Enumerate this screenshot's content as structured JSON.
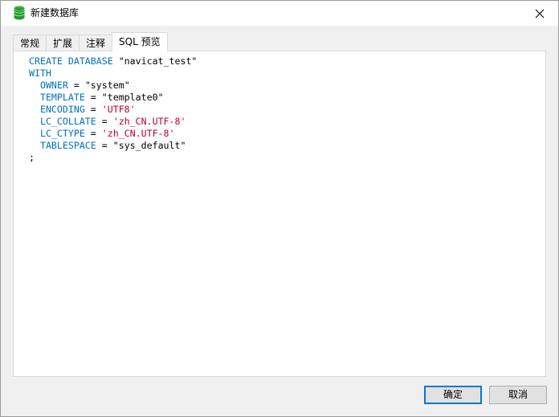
{
  "window": {
    "title": "新建数据库",
    "icon": "database-icon"
  },
  "tabs": [
    {
      "label": "常规",
      "active": false
    },
    {
      "label": "扩展",
      "active": false
    },
    {
      "label": "注释",
      "active": false
    },
    {
      "label": "SQL 预览",
      "active": true
    }
  ],
  "sql": {
    "lines": [
      {
        "indent": "",
        "parts": [
          {
            "t": "kw",
            "v": "CREATE DATABASE"
          },
          {
            "t": "p",
            "v": " "
          },
          {
            "t": "d",
            "v": "\"navicat_test\""
          }
        ]
      },
      {
        "indent": "",
        "parts": [
          {
            "t": "kw",
            "v": "WITH"
          }
        ]
      },
      {
        "indent": "  ",
        "parts": [
          {
            "t": "kw",
            "v": "OWNER"
          },
          {
            "t": "p",
            "v": " = "
          },
          {
            "t": "d",
            "v": "\"system\""
          }
        ]
      },
      {
        "indent": "  ",
        "parts": [
          {
            "t": "kw",
            "v": "TEMPLATE"
          },
          {
            "t": "p",
            "v": " = "
          },
          {
            "t": "d",
            "v": "\"template0\""
          }
        ]
      },
      {
        "indent": "  ",
        "parts": [
          {
            "t": "kw",
            "v": "ENCODING"
          },
          {
            "t": "p",
            "v": " = "
          },
          {
            "t": "s",
            "v": "'UTF8'"
          }
        ]
      },
      {
        "indent": "  ",
        "parts": [
          {
            "t": "kw",
            "v": "LC_COLLATE"
          },
          {
            "t": "p",
            "v": " = "
          },
          {
            "t": "s",
            "v": "'zh_CN.UTF-8'"
          }
        ]
      },
      {
        "indent": "  ",
        "parts": [
          {
            "t": "kw",
            "v": "LC_CTYPE"
          },
          {
            "t": "p",
            "v": " = "
          },
          {
            "t": "s",
            "v": "'zh_CN.UTF-8'"
          }
        ]
      },
      {
        "indent": "  ",
        "parts": [
          {
            "t": "kw",
            "v": "TABLESPACE"
          },
          {
            "t": "p",
            "v": " = "
          },
          {
            "t": "d",
            "v": "\"sys_default\""
          }
        ]
      },
      {
        "indent": "",
        "parts": [
          {
            "t": "p",
            "v": ";"
          }
        ]
      }
    ]
  },
  "buttons": {
    "ok_label": "确定",
    "cancel_label": "取消"
  },
  "colors": {
    "keyword": "#0070c0",
    "string_single": "#c00030",
    "accent": "#0078d7"
  }
}
